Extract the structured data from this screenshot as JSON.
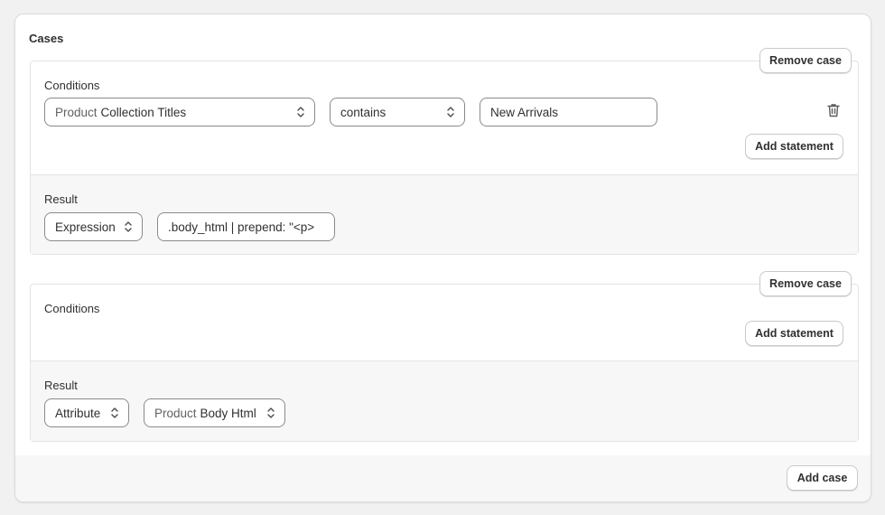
{
  "cases_title": "Cases",
  "cases": [
    {
      "remove_label": "Remove case",
      "conditions_label": "Conditions",
      "statement": {
        "attribute_prefix": "Product",
        "attribute_value": "Collection Titles",
        "operator": "contains",
        "value": "New Arrivals"
      },
      "add_statement_label": "Add statement",
      "result_label": "Result",
      "result_type": "Expression",
      "result_value": ".body_html | prepend: \"<p>"
    },
    {
      "remove_label": "Remove case",
      "conditions_label": "Conditions",
      "add_statement_label": "Add statement",
      "result_label": "Result",
      "result_type": "Attribute",
      "result_prefix": "Product",
      "result_value": "Body Html"
    }
  ],
  "add_case_label": "Add case",
  "icons": {
    "delete": "trash-icon",
    "select": "chevron-up-down-icon"
  }
}
